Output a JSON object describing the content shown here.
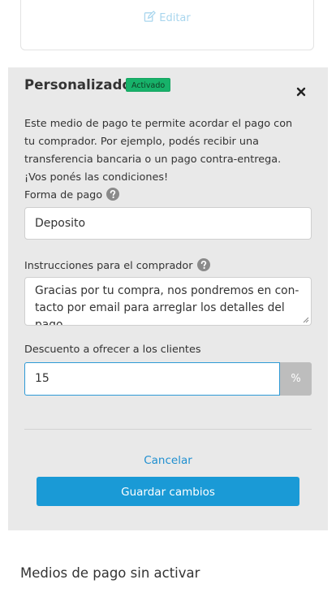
{
  "top_card": {
    "edit_label": "Editar"
  },
  "panel": {
    "title": "Personalizado",
    "badge": "Activado",
    "description": "Este medio de pago te permite acordar el pago con tu comprador. Por ejemplo, podés recibir una transferencia bancaria o un pago contra-entrega. ¡Vos ponés las condiciones!",
    "payment_form": {
      "label": "Forma de pago",
      "value": "Deposito"
    },
    "instructions": {
      "label": "Instrucciones para el comprador",
      "value": "Gracias por tu compra, nos pondremos en con-tacto por email para arreglar los detalles del pago."
    },
    "discount": {
      "label": "Descuento a ofrecer a los clientes",
      "value": "15",
      "unit": "%"
    },
    "cancel_label": "Cancelar",
    "save_label": "Guardar cambios"
  },
  "inactive_section": {
    "title": "Medios de pago sin activar"
  },
  "colors": {
    "primary": "#1a9ad6",
    "badge": "#17b26a",
    "panel_bg": "#e9e9e9"
  }
}
